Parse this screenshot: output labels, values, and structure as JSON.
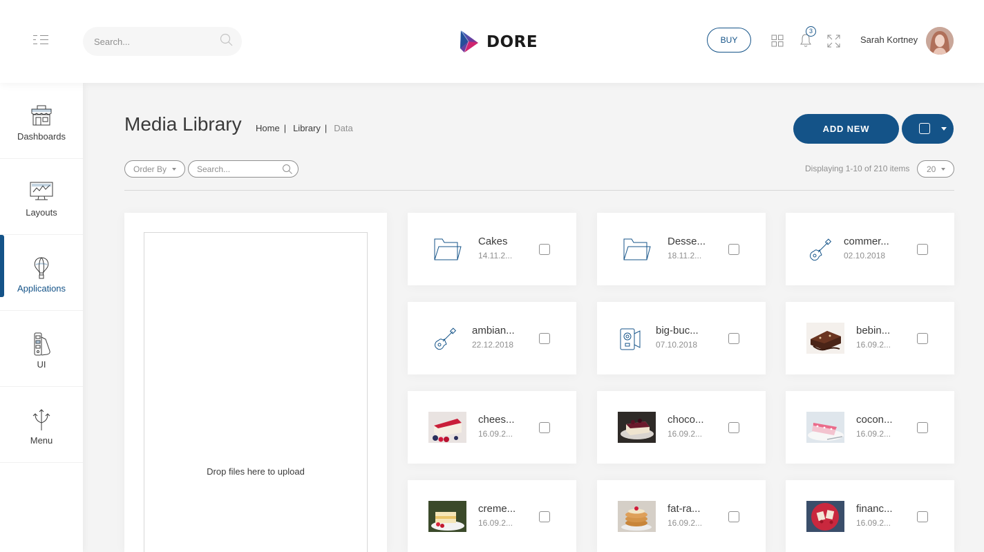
{
  "header": {
    "search_placeholder": "Search...",
    "logo_text": "DORE",
    "buy_label": "BUY",
    "notification_count": "3",
    "user_name": "Sarah Kortney"
  },
  "sidebar": {
    "items": [
      {
        "label": "Dashboards",
        "icon": "shop-icon"
      },
      {
        "label": "Layouts",
        "icon": "monitor-icon"
      },
      {
        "label": "Applications",
        "icon": "air-balloon-icon",
        "active": true
      },
      {
        "label": "UI",
        "icon": "pantone-icon"
      },
      {
        "label": "Menu",
        "icon": "three-arrows-icon"
      }
    ]
  },
  "page": {
    "title": "Media Library",
    "breadcrumb": [
      "Home",
      "Library",
      "Data"
    ],
    "add_new_label": "ADD NEW",
    "order_by_label": "Order By",
    "filter_search_placeholder": "Search...",
    "displaying_text": "Displaying 1-10 of 210 items",
    "per_page": "20",
    "dropzone_text": "Drop files here to upload"
  },
  "files": [
    {
      "name": "Cakes",
      "date": "14.11.2...",
      "kind": "folder"
    },
    {
      "name": "Desse...",
      "date": "18.11.2...",
      "kind": "folder"
    },
    {
      "name": "commer...",
      "date": "02.10.2018",
      "kind": "guitar"
    },
    {
      "name": "ambian...",
      "date": "22.12.2018",
      "kind": "guitar"
    },
    {
      "name": "big-buc...",
      "date": "07.10.2018",
      "kind": "video"
    },
    {
      "name": "bebin...",
      "date": "16.09.2...",
      "kind": "image-brownie"
    },
    {
      "name": "chees...",
      "date": "16.09.2...",
      "kind": "image-cheesecake"
    },
    {
      "name": "choco...",
      "date": "16.09.2...",
      "kind": "image-chocolate"
    },
    {
      "name": "cocon...",
      "date": "16.09.2...",
      "kind": "image-coconut"
    },
    {
      "name": "creme...",
      "date": "16.09.2...",
      "kind": "image-cremeschnitte"
    },
    {
      "name": "fat-ra...",
      "date": "16.09.2...",
      "kind": "image-pancakes"
    },
    {
      "name": "financ...",
      "date": "16.09.2...",
      "kind": "image-financier"
    }
  ],
  "colors": {
    "primary": "#145388",
    "text": "#3a3a3a",
    "muted": "#8f8f8f",
    "background": "#f4f4f4"
  }
}
